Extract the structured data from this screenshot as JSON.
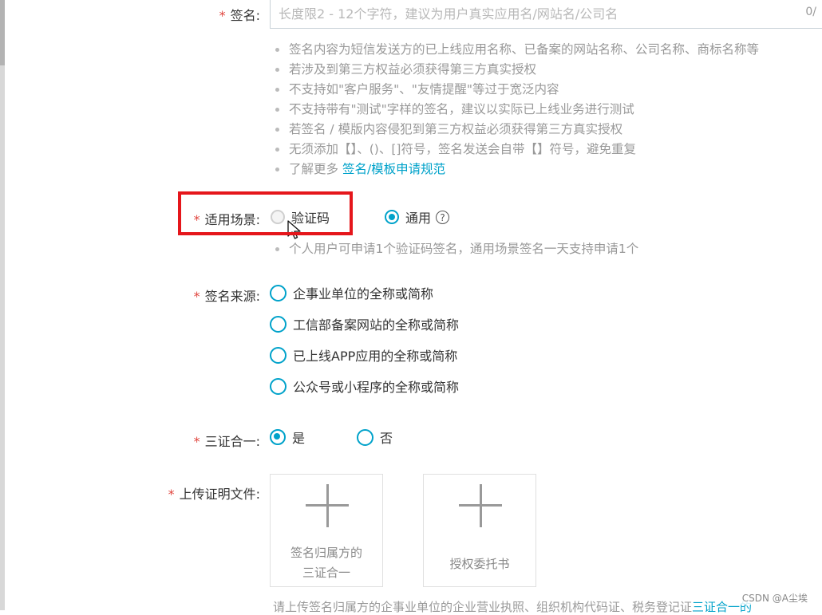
{
  "signature": {
    "label": "签名:",
    "placeholder": "长度限2 - 12个字符，建议为用户真实应用名/网站名/公司名",
    "counter": "0/",
    "hints": [
      "签名内容为短信发送方的已上线应用名称、已备案的网站名称、公司名称、商标名称等",
      "若涉及到第三方权益必须获得第三方真实授权",
      "不支持如\"客户服务\"、\"友情提醒\"等过于宽泛内容",
      "不支持带有\"测试\"字样的签名，建议以实际已上线业务进行测试",
      "若签名 / 模版内容侵犯到第三方权益必须获得第三方真实授权",
      "无须添加【】、()、[]符号，签名发送会自带【】符号，避免重复"
    ],
    "more_prefix": "了解更多",
    "more_link": "签名/模板申请规范"
  },
  "scene": {
    "label": "适用场景:",
    "options": [
      "验证码",
      "通用"
    ],
    "hint": "个人用户可申请1个验证码签名，通用场景签名一天支持申请1个"
  },
  "source": {
    "label": "签名来源:",
    "options": [
      "企事业单位的全称或简称",
      "工信部备案网站的全称或简称",
      "已上线APP应用的全称或简称",
      "公众号或小程序的全称或简称"
    ]
  },
  "three_in_one": {
    "label": "三证合一:",
    "yes": "是",
    "no": "否"
  },
  "upload": {
    "label": "上传证明文件:",
    "box1_line1": "签名归属方的",
    "box1_line2": "三证合一",
    "box2": "授权委托书"
  },
  "bottom_hint": {
    "text": "请上传签名归属方的企事业单位的企业营业执照、组织机构代码证、税务登记证",
    "link": "三证合一的"
  },
  "watermark": "CSDN @A尘埃",
  "colors": {
    "accent": "#00a2ca",
    "required": "#e0433c",
    "highlight": "#e5161b"
  }
}
